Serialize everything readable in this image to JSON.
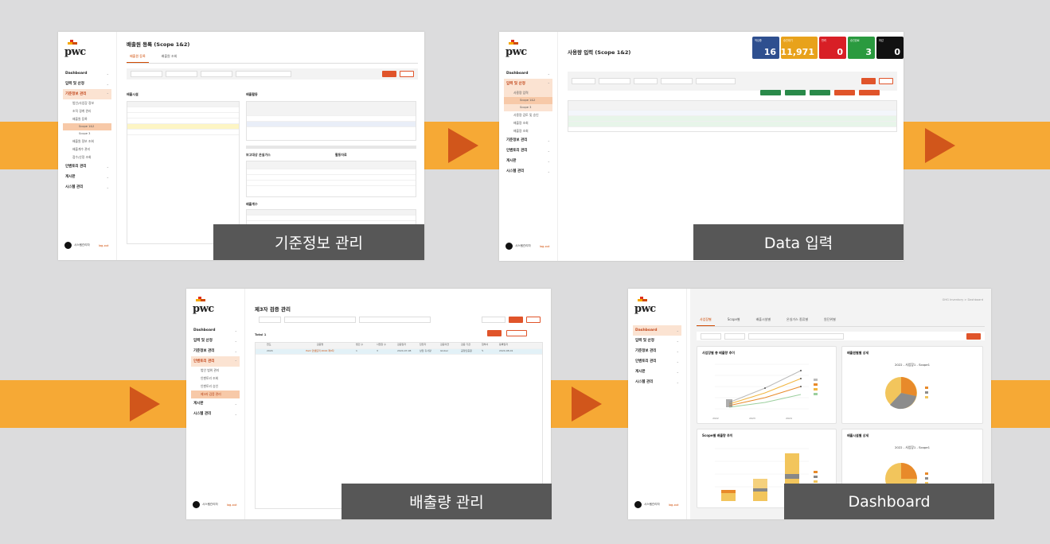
{
  "labels": {
    "standard_info": "기준정보 관리",
    "data_input": "Data 입력",
    "emission_mgmt": "배출량 관리",
    "dashboard": "Dashboard"
  },
  "colors": {
    "background": "#dcdcdd",
    "band": "#f6a935",
    "arrow": "#d1561b",
    "label_bg": "#575757",
    "accent": "#d04a02"
  },
  "shots": {
    "s1": {
      "title": "배출원 등록 (Scope 1&2)",
      "tabs": [
        "배출원 등록",
        "배출원 조회"
      ],
      "nav": [
        "Dashboard",
        "입력 및 산정",
        "기준정보 관리",
        "인벤토리 관리",
        "게시판",
        "시스템 관리"
      ],
      "subs": [
        "법인/사업장 정보",
        "조직 경계 관리",
        "배출원 등록",
        "Scope 1&2",
        "Scope 3",
        "배출원 정보 조회",
        "배출계수 관리",
        "접수/산정 조회"
      ],
      "section_left": "배출시설",
      "section_right": "배출활동",
      "sec2": "보고대상 온실가스",
      "sec3": "활동자료",
      "sec4": "배출계수",
      "user": "시스템관리자",
      "logout": "log-out"
    },
    "s2": {
      "title": "사용량 입력 (Scope 1&2)",
      "nav": [
        "Dashboard",
        "입력 및 산정",
        "기준정보 관리",
        "인벤토리 관리",
        "게시판",
        "시스템 관리"
      ],
      "subs": [
        "사용량 입력",
        "Scope 1&2",
        "Scope 3",
        "사용량 검토 및 승인",
        "배출량 조회",
        "배출량 조회"
      ],
      "tiles": [
        {
          "name": "작성중",
          "value": "16",
          "color": "#2e4f8f"
        },
        {
          "name": "승인대기",
          "value": "11,971",
          "color": "#e8a21b"
        },
        {
          "name": "반려",
          "value": "0",
          "color": "#d81f26"
        },
        {
          "name": "승인완료",
          "value": "3",
          "color": "#2a9a3f"
        },
        {
          "name": "마감",
          "value": "0",
          "color": "#111111"
        }
      ],
      "user": "시스템관리자",
      "logout": "log-out"
    },
    "s3": {
      "title": "제3자 검증 관리",
      "nav": [
        "Dashboard",
        "입력 및 산정",
        "기준정보 관리",
        "인벤토리 관리",
        "게시판",
        "시스템 관리"
      ],
      "subs": [
        "법인 범위 관리",
        "인벤토리 조회",
        "인벤토리 승인",
        "제3자 검증 관리"
      ],
      "total": "Total 1",
      "cols": [
        "연도",
        "검증명",
        "법인 수",
        "사업장 수",
        "검증일자",
        "담당자",
        "검증의견",
        "검증 기관",
        "첨부서",
        "등록일자"
      ],
      "row": [
        "2024",
        "PwC 인벤토리 2024 제3자",
        "1",
        "3",
        "2024-07-08",
        "상담 홍사랑",
        "Global",
        "공정인증원",
        "",
        "2024-08-01"
      ],
      "user": "시스템관리자",
      "logout": "log-out"
    },
    "s4": {
      "nav": [
        "Dashboard",
        "입력 및 산정",
        "기준정보 관리",
        "인벤토리 관리",
        "게시판",
        "시스템 관리"
      ],
      "tabs": [
        "사업장별",
        "Scope별",
        "배출시설별",
        "온실가스 종류별",
        "원단위별"
      ],
      "crumb": "GHG Inventory > Dashboard",
      "panel1": "사업장별 총 배출량 추이",
      "panel2": "배출원별별 상세",
      "panel3": "Scope별 배출량 추이",
      "panel4": "배출시설별 상세",
      "pie1_title": "2022 - 사업장1 - Scope1",
      "pie2_title": "2022 - 사업장1 - Scope1",
      "years": [
        "2022",
        "2023",
        "2024"
      ],
      "user": "시스템관리자",
      "logout": "log-out"
    }
  }
}
